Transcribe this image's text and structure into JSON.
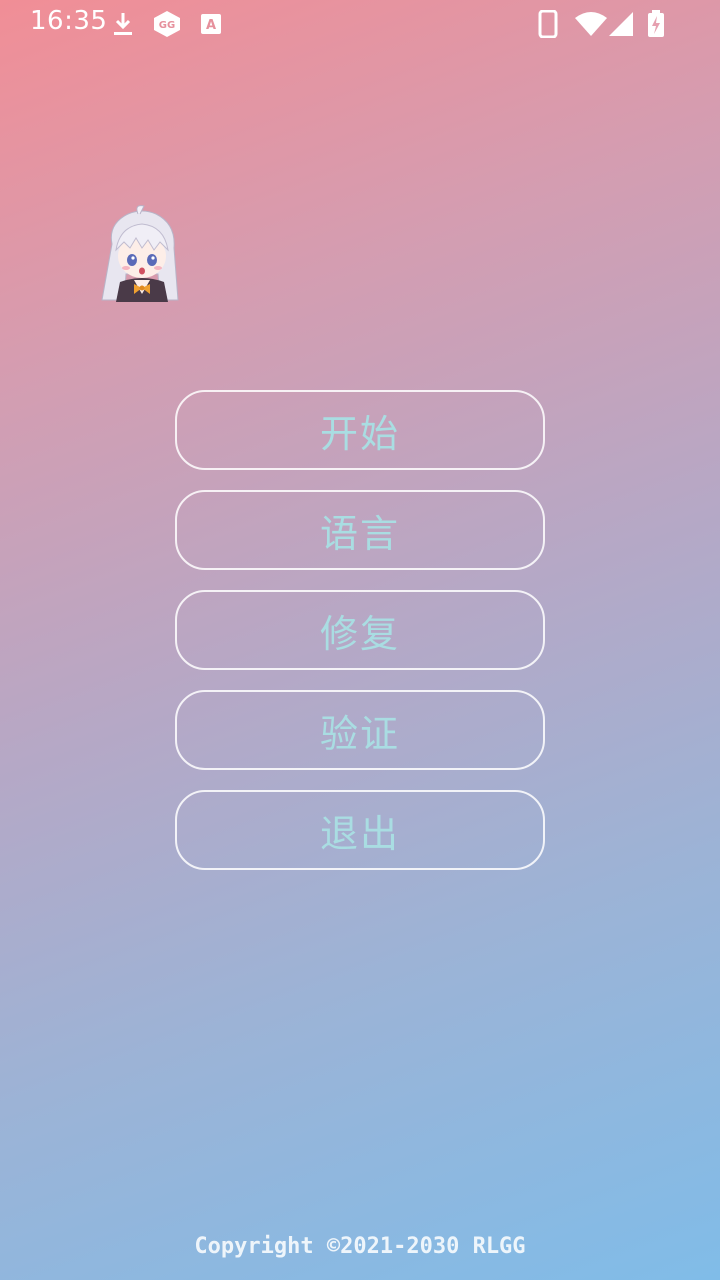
{
  "status_bar": {
    "time": "16:35",
    "icons": [
      "download-icon",
      "gg-app-icon",
      "keyboard-a-icon",
      "phone-icon",
      "wifi-icon",
      "signal-icon",
      "battery-charging-icon"
    ]
  },
  "avatar": {
    "icon": "anime-girl-avatar"
  },
  "menu": {
    "start": "开始",
    "language": "语言",
    "repair": "修复",
    "verify": "验证",
    "exit": "退出"
  },
  "footer": {
    "copyright": "Copyright ©2021-2030 RLGG"
  },
  "colors": {
    "gradient_top": "#f18e96",
    "gradient_bottom": "#80bce8",
    "button_text": "#a9dde2",
    "button_border": "#ffffff"
  }
}
